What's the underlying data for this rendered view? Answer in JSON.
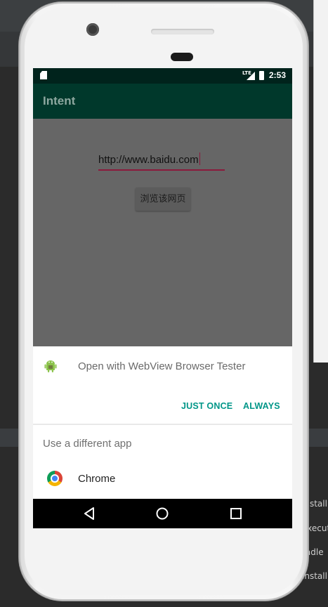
{
  "ide": {
    "background_lines": [
      "install",
      "executi",
      "radle",
      "install"
    ]
  },
  "status_bar": {
    "network": "LTE",
    "time": "2:53"
  },
  "app": {
    "title": "Intent"
  },
  "form": {
    "url_value": "http://www.baidu.com",
    "browse_button_label": "浏览该网页"
  },
  "chooser": {
    "open_with_label": "Open with WebView Browser Tester",
    "just_once_label": "JUST ONCE",
    "always_label": "ALWAYS",
    "different_app_label": "Use a different app",
    "apps": [
      {
        "name": "Chrome",
        "icon": "chrome-icon"
      }
    ]
  },
  "icons": {
    "sd_card": "sd-card-icon",
    "signal": "signal-icon",
    "battery": "battery-icon",
    "app_icon": "android-icon",
    "back": "back-icon",
    "home": "home-icon",
    "recents": "recents-icon"
  },
  "colors": {
    "status_bar": "#00231c",
    "app_bar": "#00382b",
    "accent": "#009688",
    "input_underline": "#8a1a3c",
    "scrim_content": "#666666"
  }
}
